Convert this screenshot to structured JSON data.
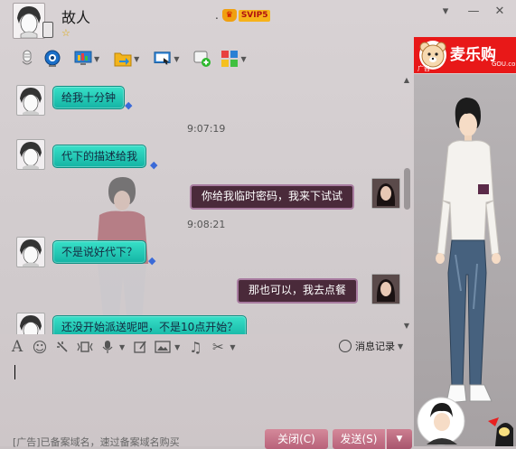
{
  "header": {
    "contact_name": "故人",
    "vip_dot": ".",
    "vip_badge": "SVIP5",
    "star": "☆"
  },
  "window_controls": {
    "menu": "▾",
    "minimize": "—",
    "close": "✕"
  },
  "toolbar": {
    "items": [
      "voice-call",
      "video-call",
      "screen-share",
      "send-file",
      "remote-assist",
      "create-group",
      "apps"
    ]
  },
  "ad": {
    "brand": "麦乐购",
    "brand_sub": "GOU.com",
    "ad_tag": "广告"
  },
  "chat": {
    "messages": [
      {
        "side": "left",
        "text": "给我十分钟"
      },
      {
        "side": "time",
        "text": "9:07:19"
      },
      {
        "side": "left",
        "text": "代下的描述给我"
      },
      {
        "side": "right",
        "text": "你给我临时密码，我来下试试"
      },
      {
        "side": "time",
        "text": "9:08:21"
      },
      {
        "side": "left",
        "text": "不是说好代下？"
      },
      {
        "side": "right",
        "text": "那也可以，我去点餐"
      },
      {
        "side": "left",
        "text": "还没开始派送呢吧，不是10点开始？"
      }
    ]
  },
  "input_toolbar": {
    "font": "A",
    "emoji": "☺",
    "history_label": "消息记录"
  },
  "input": {
    "value": ""
  },
  "footer": {
    "ad_text": "[广告]已备案域名，速过备案域名购买",
    "close_label": "关闭(C)",
    "send_label": "发送(S)"
  },
  "colors": {
    "bubble_left": "#1fc4b0",
    "bubble_right": "#4a2a3a",
    "button": "#c87088",
    "ad_red": "#e81818"
  }
}
